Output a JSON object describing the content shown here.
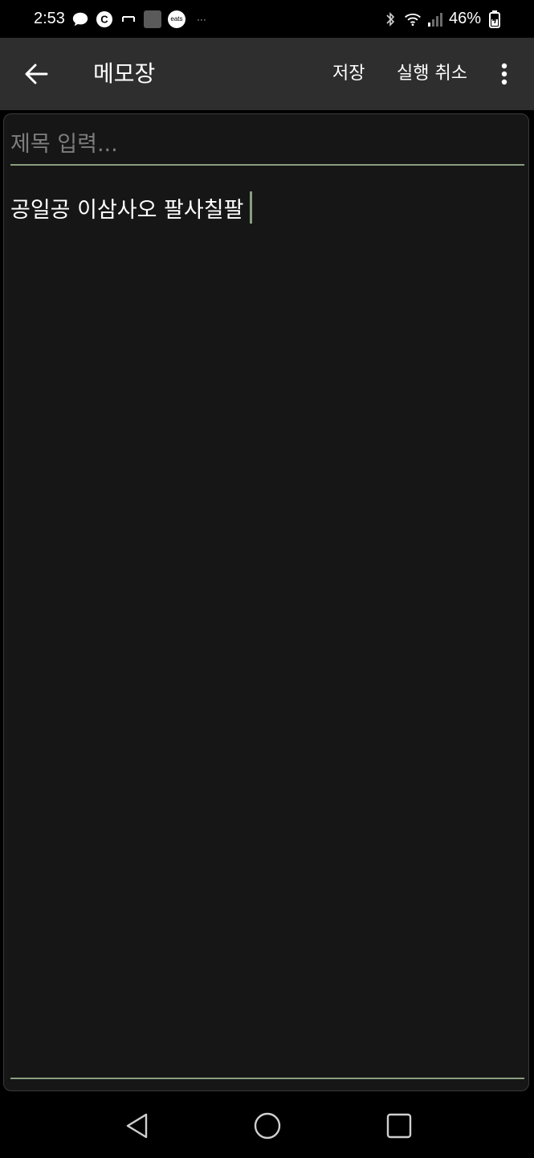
{
  "status_bar": {
    "time": "2:53",
    "c_badge": "C",
    "eats_label": "eats",
    "more_indicator": "···",
    "battery": "46%"
  },
  "app_bar": {
    "title": "메모장",
    "save_label": "저장",
    "undo_label": "실행 취소"
  },
  "editor": {
    "title_placeholder": "제목 입력...",
    "title_value": "",
    "body_text": "공일공 이삼사오 팔사칠팔"
  },
  "colors": {
    "background": "#000000",
    "app_bar": "#2e2e2e",
    "editor_background": "#161616",
    "accent_underline": "#8a9d7e",
    "placeholder": "#7d7d7d",
    "text": "#ffffff"
  },
  "icons": {
    "back": "arrow-left-icon",
    "overflow": "more-vertical-icon",
    "nav_back": "triangle-back-icon",
    "nav_home": "circle-home-icon",
    "nav_recents": "square-recents-icon"
  }
}
